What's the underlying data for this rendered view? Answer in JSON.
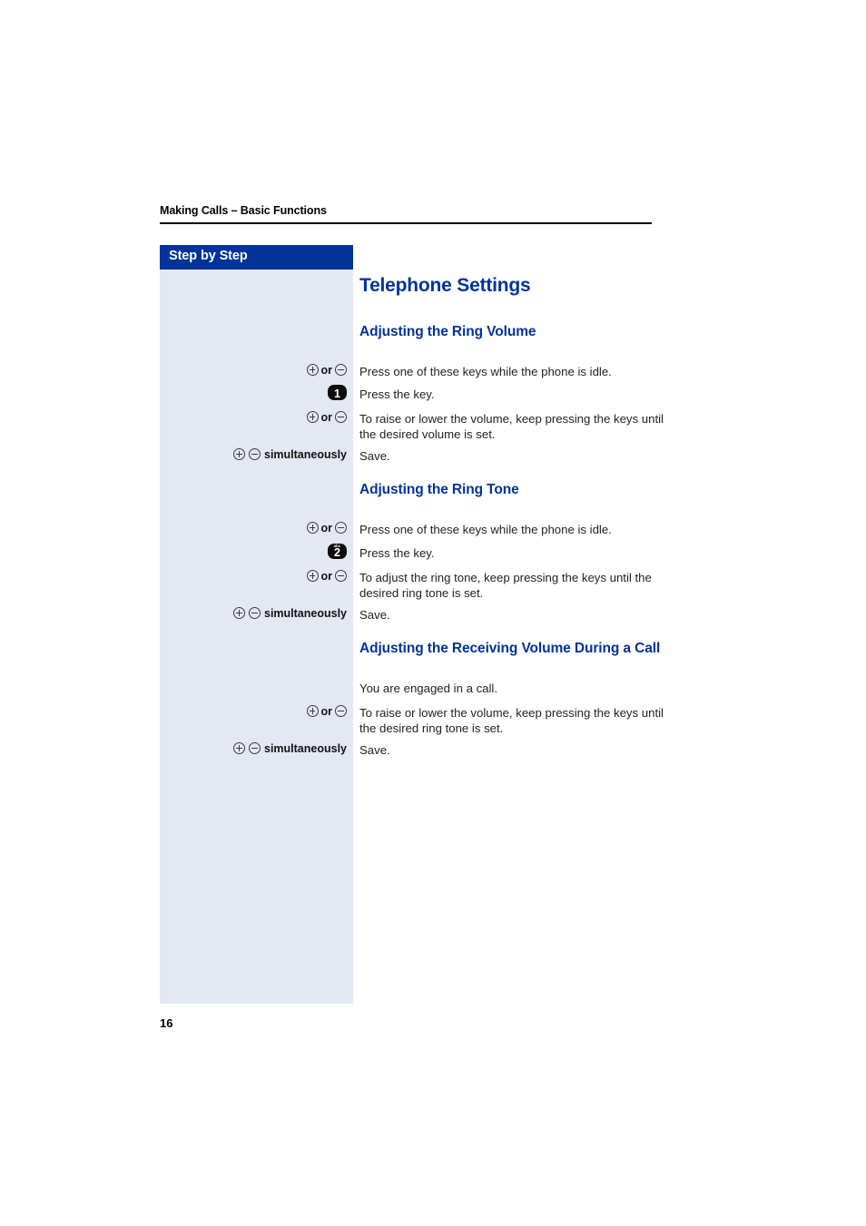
{
  "header": {
    "running_title": "Making Calls – Basic Functions"
  },
  "sidebar": {
    "title": "Step by Step"
  },
  "main": {
    "page_title": "Telephone Settings",
    "sections": [
      {
        "heading": "Adjusting the Ring Volume",
        "steps": [
          {
            "cue_type": "plus-or-minus",
            "cue_or_label": "or",
            "text": "Press one of these keys while the phone is idle."
          },
          {
            "cue_type": "keypad-key",
            "key_digit": "1",
            "key_letters": "",
            "text": "Press the key."
          },
          {
            "cue_type": "plus-or-minus",
            "cue_or_label": "or",
            "text": "To raise or lower the volume, keep pressing the keys until the desired volume is set."
          },
          {
            "cue_type": "plus-minus-simultaneously",
            "cue_label": "simultaneously",
            "text": "Save."
          }
        ]
      },
      {
        "heading": "Adjusting the Ring Tone",
        "steps": [
          {
            "cue_type": "plus-or-minus",
            "cue_or_label": "or",
            "text": "Press one of these keys while the phone is idle."
          },
          {
            "cue_type": "keypad-key",
            "key_digit": "2",
            "key_letters": "abc",
            "text": "Press the key."
          },
          {
            "cue_type": "plus-or-minus",
            "cue_or_label": "or",
            "text": "To adjust the ring tone, keep pressing the keys until the desired ring tone is set."
          },
          {
            "cue_type": "plus-minus-simultaneously",
            "cue_label": "simultaneously",
            "text": "Save."
          }
        ]
      },
      {
        "heading": "Adjusting the Receiving Volume During a Call",
        "steps": [
          {
            "cue_type": "none",
            "text": "You are engaged in a call."
          },
          {
            "cue_type": "plus-or-minus",
            "cue_or_label": "or",
            "text": "To raise or lower the volume, keep pressing the keys until the desired ring tone is set."
          },
          {
            "cue_type": "plus-minus-simultaneously",
            "cue_label": "simultaneously",
            "text": "Save."
          }
        ]
      }
    ]
  },
  "footer": {
    "page_number": "16"
  },
  "colors": {
    "brand_blue": "#013399",
    "sidebar_tint": "#e3e8f3",
    "body_text": "#222222"
  }
}
